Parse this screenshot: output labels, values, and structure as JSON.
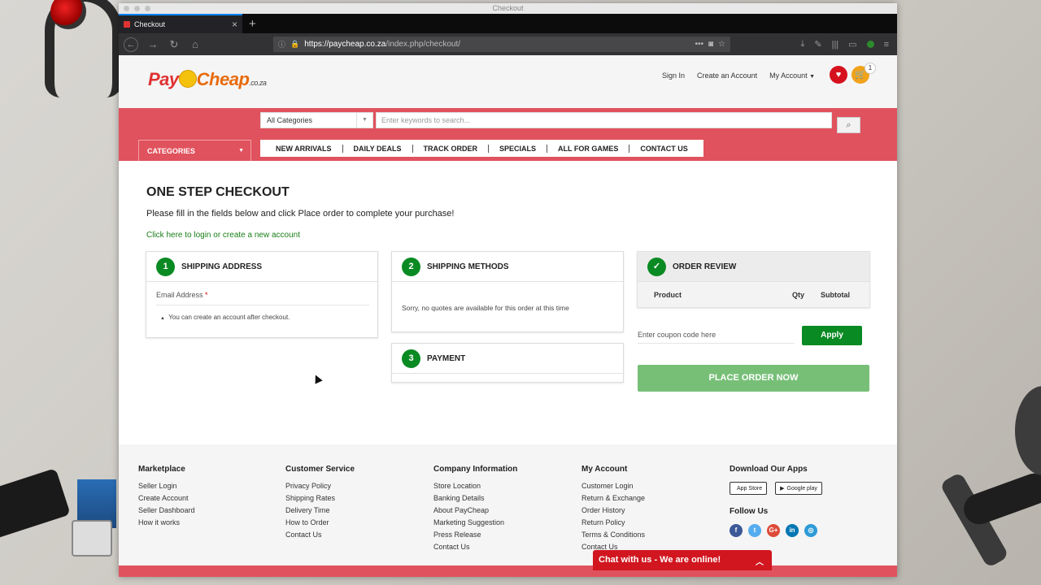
{
  "browser": {
    "window_title": "Checkout",
    "tab_title": "Checkout",
    "url_host": "https://paycheap.co.za",
    "url_path": "/index.php/checkout/"
  },
  "logo": {
    "pay": "Pay",
    "cheap": "Cheap",
    "coza": ".co.za"
  },
  "header_links": {
    "sign_in": "Sign In",
    "create_account": "Create an Account",
    "my_account": "My Account"
  },
  "cart_count": "1",
  "search": {
    "category": "All Categories",
    "placeholder": "Enter keywords to search..."
  },
  "categories_label": "CATEGORIES",
  "menu": [
    "NEW ARRIVALS",
    "DAILY DEALS",
    "TRACK ORDER",
    "SPECIALS",
    "ALL FOR GAMES",
    "CONTACT US"
  ],
  "checkout": {
    "title": "ONE STEP CHECKOUT",
    "subtitle": "Please fill in the fields below and click Place order to complete your purchase!",
    "login_link": "Click here to login or create a new account",
    "shipping_address": {
      "number": "1",
      "title": "SHIPPING ADDRESS",
      "email_label": "Email Address",
      "required_mark": "*",
      "account_note": "You can create an account after checkout."
    },
    "shipping_methods": {
      "number": "2",
      "title": "SHIPPING METHODS",
      "message": "Sorry, no quotes are available for this order at this time"
    },
    "payment": {
      "number": "3",
      "title": "PAYMENT"
    },
    "order_review": {
      "title": "ORDER REVIEW",
      "columns": [
        "Product",
        "Qty",
        "Subtotal"
      ]
    },
    "coupon_placeholder": "Enter coupon code here",
    "apply_label": "Apply",
    "place_order_label": "PLACE ORDER NOW"
  },
  "footer": {
    "columns": [
      {
        "title": "Marketplace",
        "links": [
          "Seller Login",
          "Create Account",
          "Seller Dashboard",
          "How it works"
        ]
      },
      {
        "title": "Customer Service",
        "links": [
          "Privacy Policy",
          "Shipping Rates",
          "Delivery Time",
          "How to Order",
          "Contact Us"
        ]
      },
      {
        "title": "Company Information",
        "links": [
          "Store Location",
          "Banking Details",
          "About PayCheap",
          "Marketing Suggestion",
          "Press Release",
          "Contact Us"
        ]
      },
      {
        "title": "My Account",
        "links": [
          "Customer Login",
          "Return & Exchange",
          "Order History",
          "Return Policy",
          "Terms & Conditions",
          "Contact Us"
        ]
      }
    ],
    "apps_title": "Download Our Apps",
    "app_store": "App Store",
    "google_play": "Google play",
    "follow_title": "Follow Us"
  },
  "chat_label": "Chat with us - We are online!",
  "colors": {
    "brand_red": "#e0525d",
    "green": "#0a8a23",
    "place_order": "#77bf77"
  }
}
